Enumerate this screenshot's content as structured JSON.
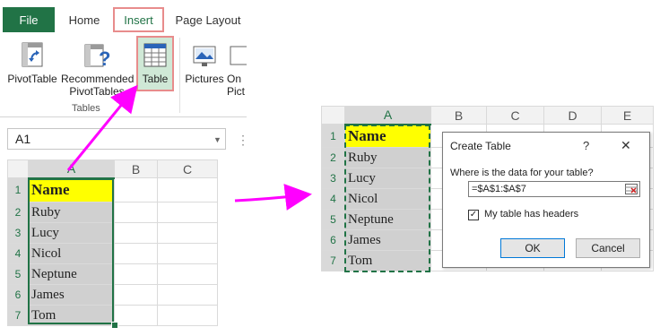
{
  "ribbon": {
    "tabs": {
      "file": "File",
      "home": "Home",
      "insert": "Insert",
      "page_layout": "Page Layout"
    },
    "buttons": {
      "pivottable": "PivotTable",
      "recommended_line1": "Recommended",
      "recommended_line2": "PivotTables",
      "table": "Table",
      "pictures": "Pictures",
      "online_line1": "On",
      "online_line2": "Pict"
    },
    "group_label": "Tables"
  },
  "namebox": {
    "value": "A1"
  },
  "sheet": {
    "columns": [
      "A",
      "B",
      "C"
    ],
    "right_columns": [
      "A",
      "B",
      "C",
      "D",
      "E"
    ],
    "rows": [
      "1",
      "2",
      "3",
      "4",
      "5",
      "6",
      "7"
    ],
    "values": [
      "Name",
      "Ruby",
      "Lucy",
      "Nicol",
      "Neptune",
      "James",
      "Tom"
    ]
  },
  "dialog": {
    "title": "Create Table",
    "help": "?",
    "close": "✕",
    "question": "Where is the data for your table?",
    "range": "=$A$1:$A$7",
    "checkbox_label": "My table has headers",
    "checkbox_checked": true,
    "ok": "OK",
    "cancel": "Cancel"
  },
  "colors": {
    "accent": "#217346",
    "highlight": "#ff00ff",
    "header_fill": "#ffff00",
    "callout": "#e88c8c"
  }
}
